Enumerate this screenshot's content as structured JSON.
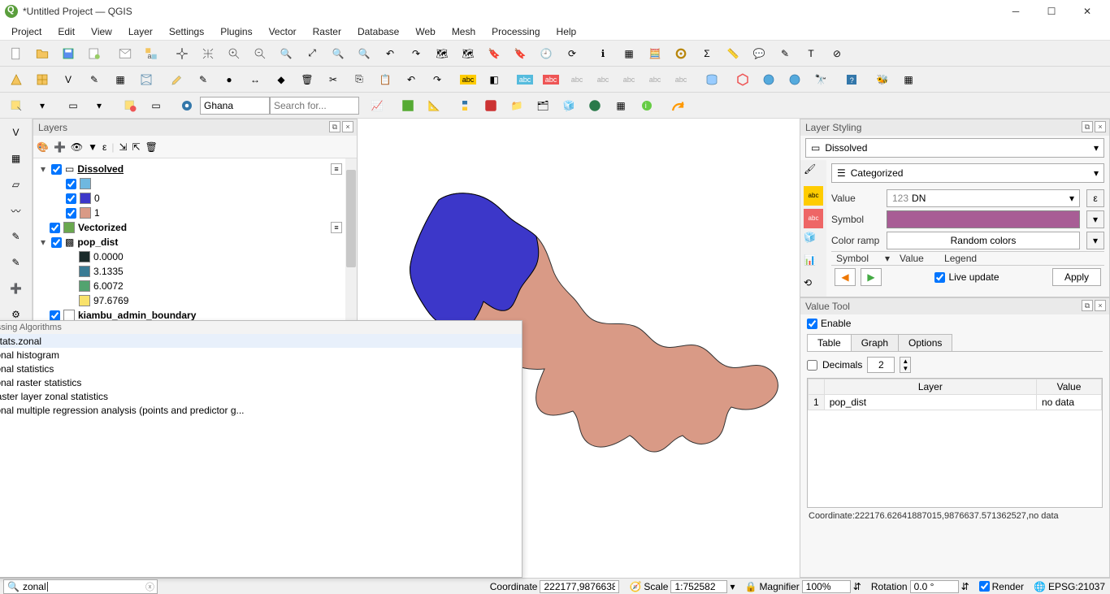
{
  "window": {
    "title": "*Untitled Project — QGIS"
  },
  "menu": [
    "Project",
    "Edit",
    "View",
    "Layer",
    "Settings",
    "Plugins",
    "Vector",
    "Raster",
    "Database",
    "Web",
    "Mesh",
    "Processing",
    "Help"
  ],
  "toolbar3": {
    "combo_value": "Ghana",
    "search_placeholder": "Search for..."
  },
  "layers_panel": {
    "title": "Layers",
    "tree": {
      "dissolved": {
        "label": "Dissolved",
        "items": [
          {
            "label": "",
            "color": "#6fb8e0"
          },
          {
            "label": "0",
            "color": "#3c37c9"
          },
          {
            "label": "1",
            "color": "#d99a86"
          }
        ]
      },
      "vectorized": {
        "label": "Vectorized",
        "swatch": "#6aa84f"
      },
      "pop_dist": {
        "label": "pop_dist",
        "items": [
          {
            "label": "0.0000",
            "color": "#1a2b2a"
          },
          {
            "label": "3.1335",
            "color": "#3a7b94"
          },
          {
            "label": "6.0072",
            "color": "#52a36f"
          },
          {
            "label": "97.6769",
            "color": "#f9e26b"
          }
        ]
      },
      "kiambu": {
        "label": "kiambu_admin_boundary",
        "swatch": "#ffffff"
      }
    }
  },
  "locator": {
    "title": "Processing Algorithms",
    "query": "zonal",
    "items": [
      {
        "label": "r.stats.zonal",
        "icon": "grass"
      },
      {
        "label": "Zonal histogram",
        "icon": "qgis"
      },
      {
        "label": "Zonal statistics",
        "icon": "qgis"
      },
      {
        "label": "Zonal raster statistics",
        "icon": "saga"
      },
      {
        "label": "Raster layer zonal statistics",
        "icon": "qgis"
      },
      {
        "label": "Zonal multiple regression analysis (points and predictor g...",
        "icon": "saga"
      }
    ]
  },
  "styling": {
    "title": "Layer Styling",
    "layer": "Dissolved",
    "renderer": "Categorized",
    "value_label": "Value",
    "value_field": "DN",
    "value_prefix": "123",
    "epsilon": "ε",
    "symbol_label": "Symbol",
    "ramp_label": "Color ramp",
    "ramp_value": "Random colors",
    "columns": {
      "symbol": "Symbol",
      "value": "Value",
      "legend": "Legend"
    },
    "live_update": "Live update",
    "apply": "Apply"
  },
  "value_tool": {
    "title": "Value Tool",
    "enable": "Enable",
    "tabs": [
      "Table",
      "Graph",
      "Options"
    ],
    "decimals_label": "Decimals",
    "decimals_value": "2",
    "columns": {
      "layer": "Layer",
      "value": "Value"
    },
    "rows": [
      {
        "idx": "1",
        "layer": "pop_dist",
        "value": "no data"
      }
    ],
    "coord_line": "Coordinate:222176.62641887015,9876637.571362527,no data"
  },
  "status": {
    "coordinate_label": "Coordinate",
    "coordinate": "222177,9876638",
    "scale_label": "Scale",
    "scale": "1:752582",
    "magnifier_label": "Magnifier",
    "magnifier": "100%",
    "rotation_label": "Rotation",
    "rotation": "0.0 °",
    "render": "Render",
    "crs": "EPSG:21037"
  }
}
